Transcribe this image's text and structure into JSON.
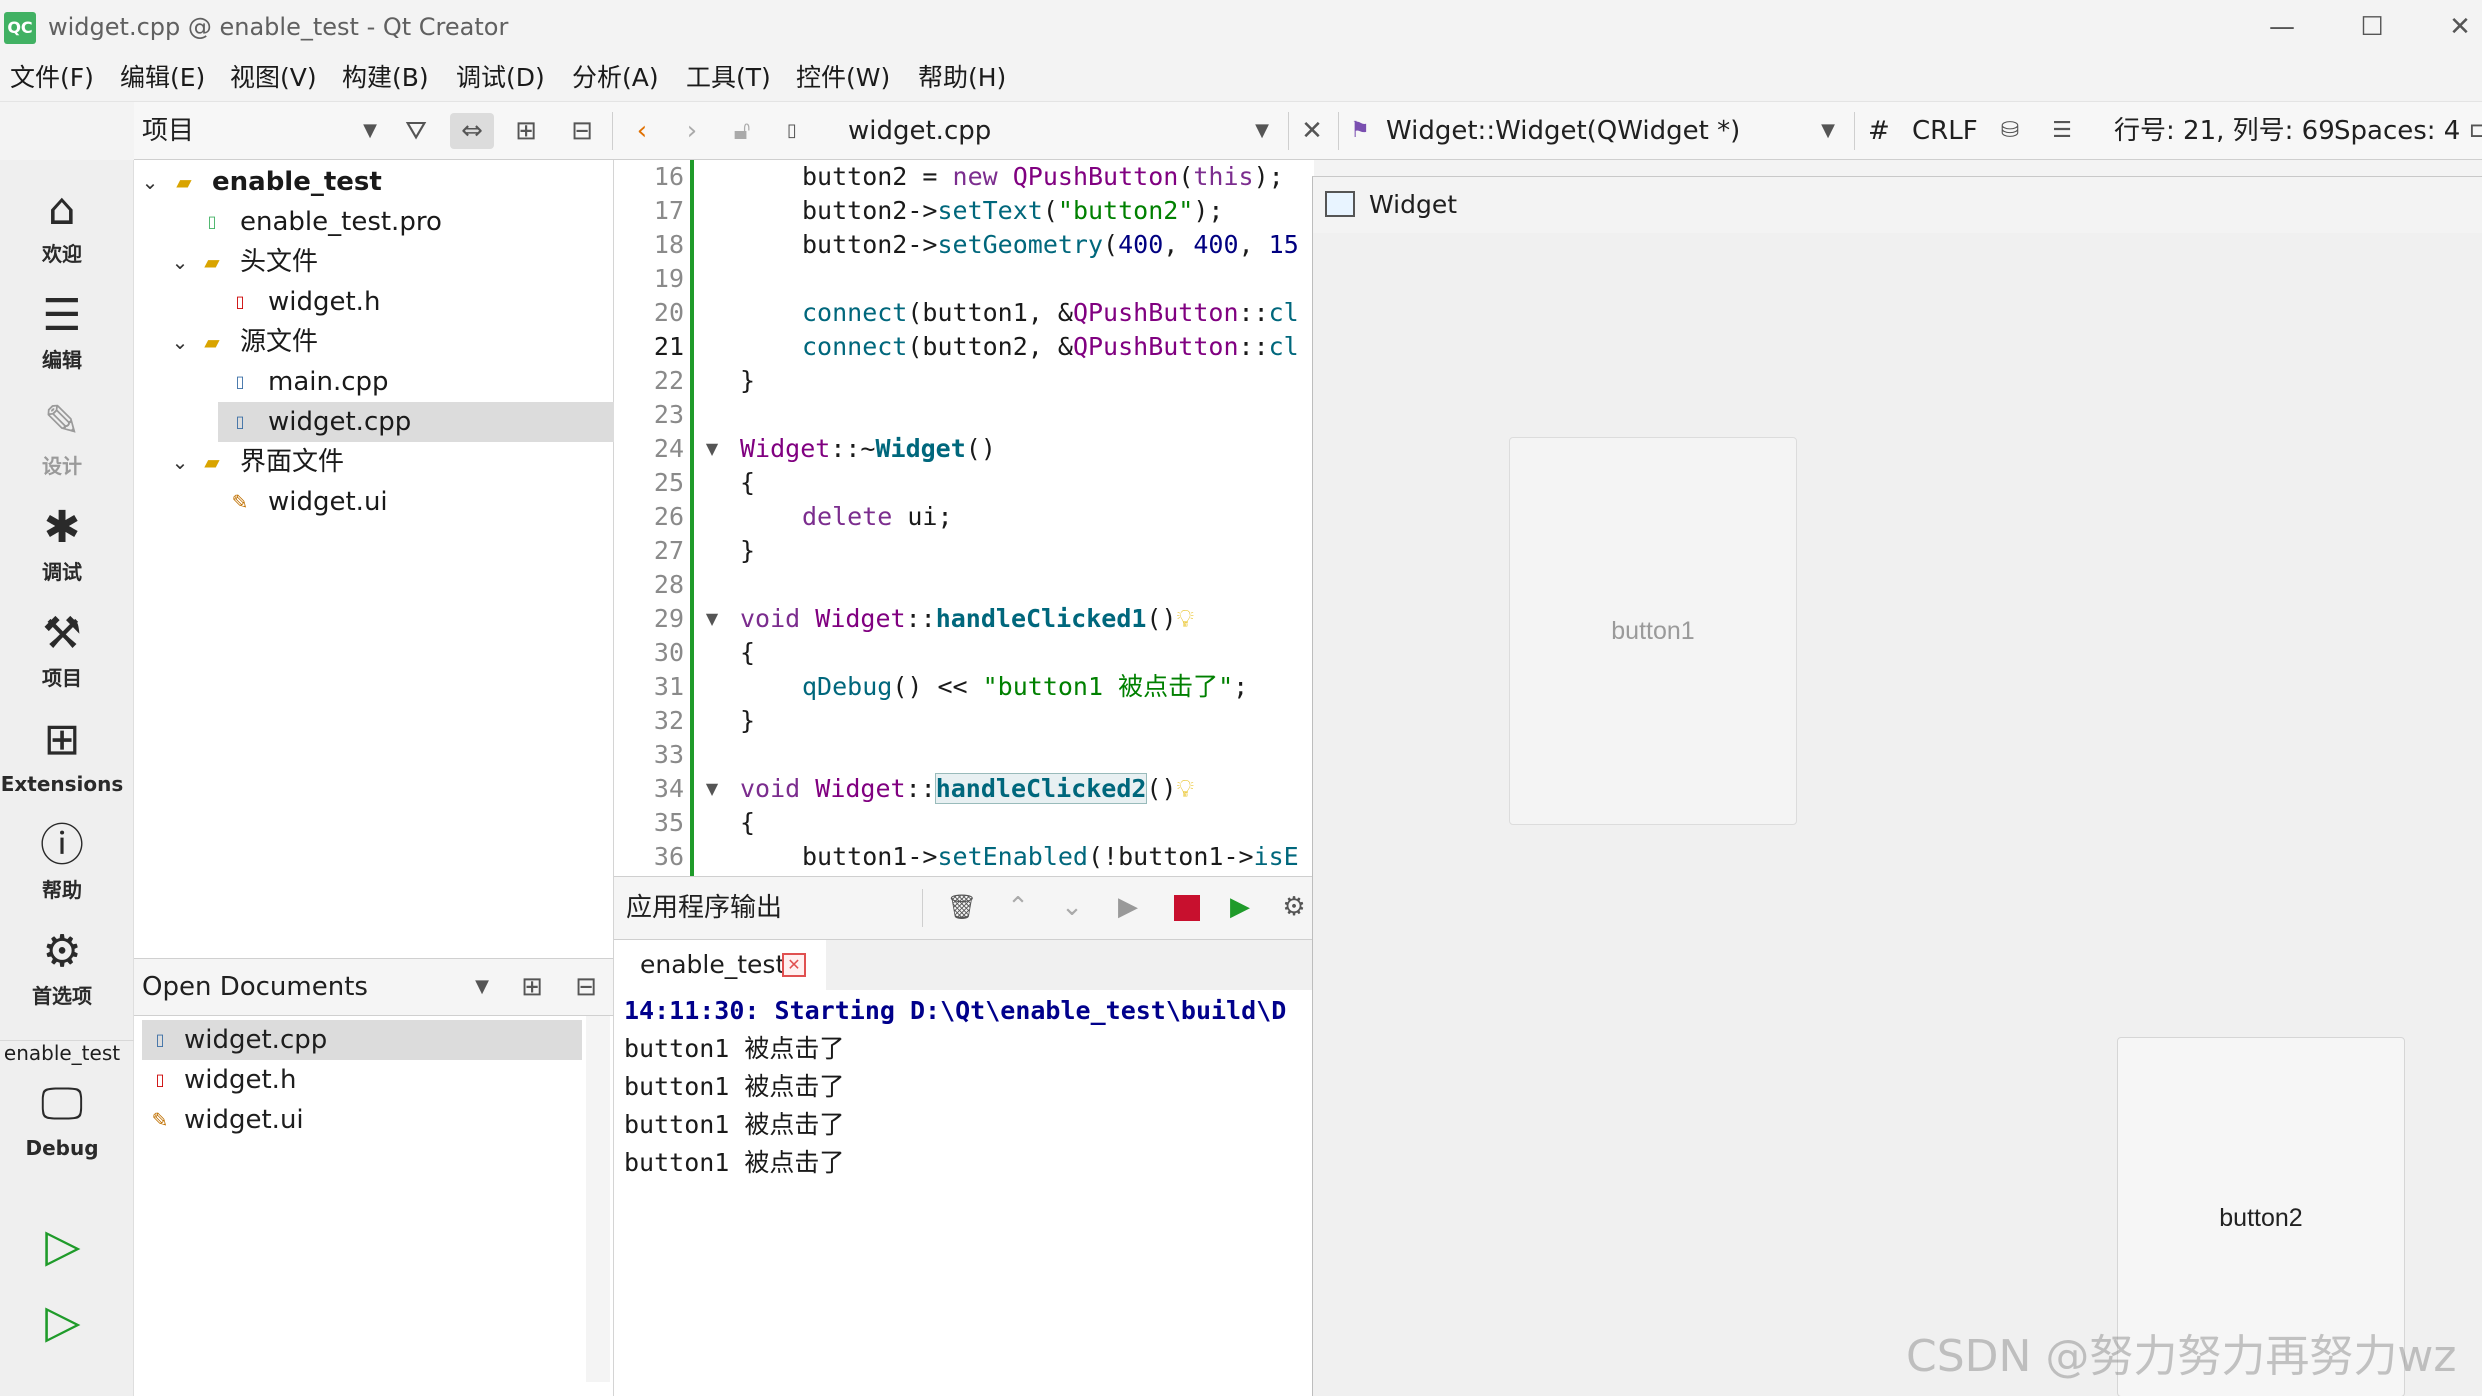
{
  "window": {
    "app_icon_text": "QC",
    "title": "widget.cpp @ enable_test - Qt Creator",
    "minimize_glyph": "—",
    "maximize_glyph": "☐",
    "close_glyph": "✕"
  },
  "menu": [
    "文件(F)",
    "编辑(E)",
    "视图(V)",
    "构建(B)",
    "调试(D)",
    "分析(A)",
    "工具(T)",
    "控件(W)",
    "帮助(H)"
  ],
  "toolbar": {
    "project_selector": "项目",
    "file_tab": "widget.cpp",
    "symbol": "Widget::Widget(QWidget *)",
    "hash": "#",
    "line_ending": "CRLF",
    "position": "行号: 21, 列号: 69",
    "spaces": "Spaces: 4"
  },
  "modes": [
    {
      "label": "欢迎",
      "icon": "home-icon"
    },
    {
      "label": "编辑",
      "icon": "edit-icon"
    },
    {
      "label": "设计",
      "icon": "design-icon"
    },
    {
      "label": "调试",
      "icon": "debug-icon"
    },
    {
      "label": "项目",
      "icon": "wrench-icon"
    },
    {
      "label": "Extensions",
      "icon": "extensions-icon"
    },
    {
      "label": "帮助",
      "icon": "help-icon"
    },
    {
      "label": "首选项",
      "icon": "gear-icon"
    }
  ],
  "kit": {
    "project": "enable_test",
    "config": "Debug"
  },
  "tree": [
    {
      "label": "enable_test",
      "level": 0,
      "expanded": true,
      "icon": "project-folder-icon",
      "bold": true
    },
    {
      "label": "enable_test.pro",
      "level": 1,
      "icon": "pro-file-icon"
    },
    {
      "label": "头文件",
      "level": 1,
      "expanded": true,
      "icon": "header-folder-icon"
    },
    {
      "label": "widget.h",
      "level": 2,
      "icon": "header-file-icon"
    },
    {
      "label": "源文件",
      "level": 1,
      "expanded": true,
      "icon": "source-folder-icon"
    },
    {
      "label": "main.cpp",
      "level": 2,
      "icon": "cpp-file-icon"
    },
    {
      "label": "widget.cpp",
      "level": 2,
      "icon": "cpp-file-icon",
      "selected": true
    },
    {
      "label": "界面文件",
      "level": 1,
      "expanded": true,
      "icon": "form-folder-icon"
    },
    {
      "label": "widget.ui",
      "level": 2,
      "icon": "ui-file-icon"
    }
  ],
  "open_documents": {
    "title": "Open Documents",
    "items": [
      {
        "label": "widget.cpp",
        "selected": true
      },
      {
        "label": "widget.h"
      },
      {
        "label": "widget.ui"
      }
    ]
  },
  "editor": {
    "line_numbers": [
      "16",
      "17",
      "18",
      "19",
      "20",
      "21",
      "22",
      "23",
      "24",
      "25",
      "26",
      "27",
      "28",
      "29",
      "30",
      "31",
      "32",
      "33",
      "34",
      "35",
      "36"
    ],
    "current_line": "21"
  },
  "output": {
    "title": "应用程序输出",
    "tab": "enable_test",
    "lines": [
      "14:11:30: Starting D:\\Qt\\enable_test\\build\\D",
      "button1 被点击了",
      "button1 被点击了",
      "button1 被点击了",
      "button1 被点击了"
    ]
  },
  "widget_window": {
    "title": "Widget",
    "button1": "button1",
    "button2": "button2"
  },
  "watermark": "CSDN @努力努力再努力wz"
}
